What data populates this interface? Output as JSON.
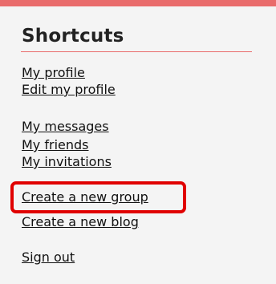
{
  "sidebar": {
    "title": "Shortcuts",
    "links": {
      "my_profile": "My profile",
      "edit_my_profile": "Edit my profile",
      "my_messages": "My messages",
      "my_friends": "My friends",
      "my_invitations": "My invitations",
      "create_group": "Create a new group",
      "create_blog": "Create a new blog",
      "sign_out": "Sign out"
    }
  },
  "colors": {
    "accent": "#e96b6b",
    "highlight": "#e00000"
  }
}
